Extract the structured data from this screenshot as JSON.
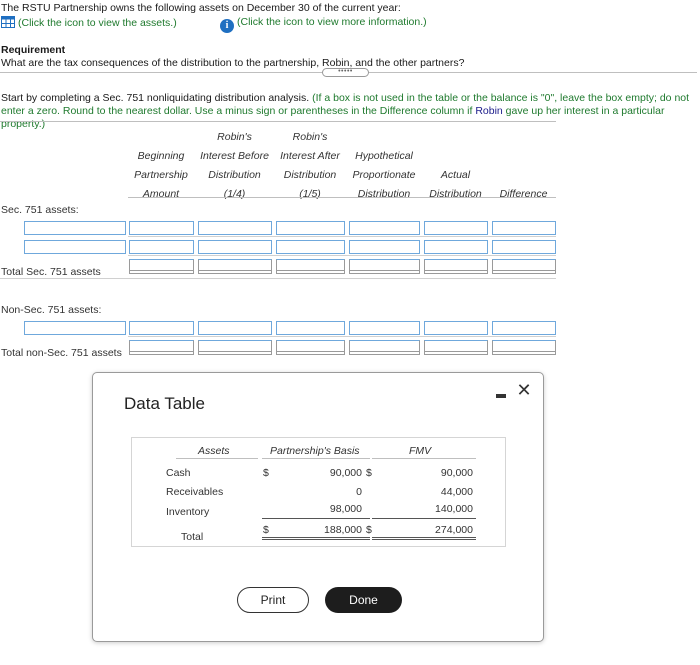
{
  "intro": {
    "text": "The RSTU Partnership owns the following assets on December 30 of the current year:"
  },
  "links": {
    "assets": "(Click the icon to view the assets.)",
    "info": "(Click the icon to view more information.)"
  },
  "requirement": {
    "heading": "Requirement",
    "question": "What are the tax consequences of the distribution to the partnership, Robin, and the other partners?"
  },
  "expand_label": "•••••",
  "instructions": {
    "lead": "Start by completing a Sec. 751 nonliquidating distribution analysis.",
    "green_a": " (If a box is not used in the table or the balance is \"0\", leave the box empty; do not enter a zero. Round to the nearest dollar. Use a minus sign or parentheses in the Difference column if ",
    "robin": "Robin",
    "green_b": " gave up her interest in a particular property.)"
  },
  "columns": {
    "beginning": [
      "Beginning",
      "Partnership",
      "Amount"
    ],
    "before": [
      "Robin's",
      "Interest Before",
      "Distribution",
      "(1/4)"
    ],
    "after": [
      "Robin's",
      "Interest After",
      "Distribution",
      "(1/5)"
    ],
    "hypothetical": [
      "Hypothetical",
      "Proportionate",
      "Distribution"
    ],
    "actual": [
      "Actual",
      "Distribution"
    ],
    "difference": "Difference"
  },
  "rows": {
    "sec751": "Sec. 751 assets:",
    "total_sec751": "Total Sec. 751 assets",
    "nonsec751": "Non-Sec. 751 assets:",
    "total_nonsec751": "Total non-Sec. 751 assets"
  },
  "modal": {
    "title": "Data Table",
    "minimize_icon": "minimize-icon",
    "close_icon": "close-icon",
    "close_glyph": "✕",
    "table": {
      "headers": {
        "assets": "Assets",
        "basis": "Partnership's Basis",
        "fmv": "FMV"
      },
      "rows": [
        {
          "asset": "Cash",
          "basis_sym": "$",
          "basis": "90,000",
          "fmv_sym": "$",
          "fmv": "90,000"
        },
        {
          "asset": "Receivables",
          "basis_sym": "",
          "basis": "0",
          "fmv_sym": "",
          "fmv": "44,000"
        },
        {
          "asset": "Inventory",
          "basis_sym": "",
          "basis": "98,000",
          "fmv_sym": "",
          "fmv": "140,000"
        }
      ],
      "total": {
        "asset": "Total",
        "basis_sym": "$",
        "basis": "188,000",
        "fmv_sym": "$",
        "fmv": "274,000"
      }
    },
    "print_label": "Print",
    "done_label": "Done"
  },
  "colors": {
    "link_green": "#1f7a2e",
    "input_border": "#6fa8dc",
    "info_blue": "#1f6fc1",
    "done_bg": "#1d1d1d"
  }
}
